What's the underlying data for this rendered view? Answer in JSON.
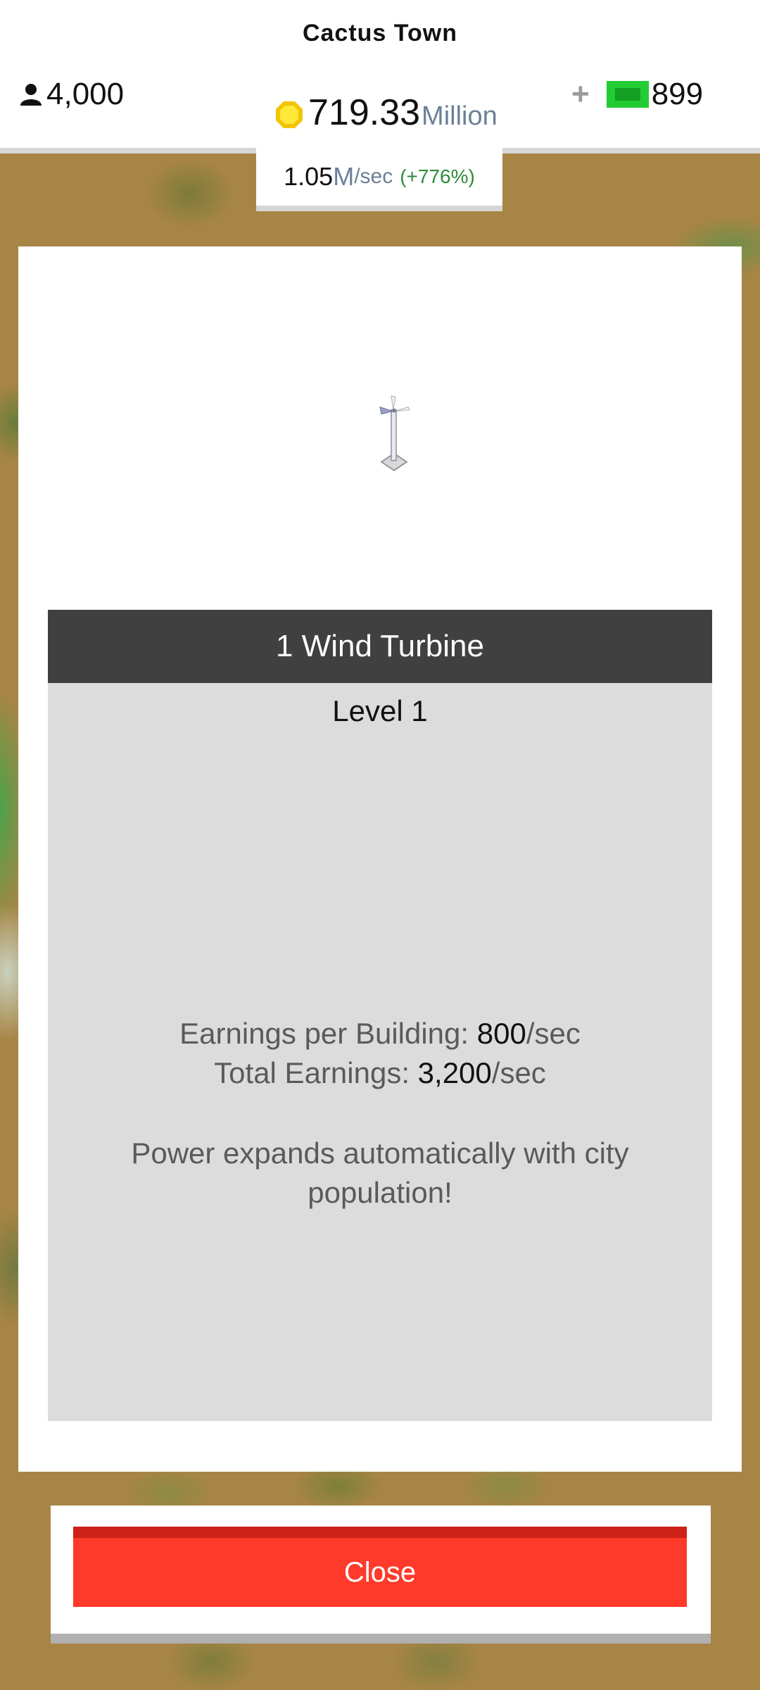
{
  "header": {
    "town_name": "Cactus Town",
    "population": "4,000",
    "coins_value": "719.33",
    "coins_unit": "Million",
    "cash_plus": "+",
    "cash_value": "899",
    "rate_value": "1.05",
    "rate_unit": "M",
    "rate_per": "/sec",
    "rate_change": "(+776%)",
    "icons": {
      "population": "person-icon",
      "coins": "coin-icon",
      "cash": "cash-icon"
    }
  },
  "building": {
    "icon": "wind-turbine-icon",
    "title": "1 Wind Turbine",
    "level": "Level 1",
    "earnings_per_building_label": "Earnings per Building: ",
    "earnings_per_building_value": "800",
    "earnings_per_building_unit": "/sec",
    "total_earnings_label": "Total Earnings: ",
    "total_earnings_value": "3,200",
    "total_earnings_unit": "/sec",
    "note": "Power expands automatically with city population!"
  },
  "actions": {
    "close_label": "Close"
  },
  "colors": {
    "close_button": "#ff3a2a",
    "title_bar": "#404040",
    "info_panel": "#dcdcdc",
    "rate_change": "#2e8b3a",
    "unit_text": "#6b8098",
    "cash_icon": "#22cc33"
  }
}
